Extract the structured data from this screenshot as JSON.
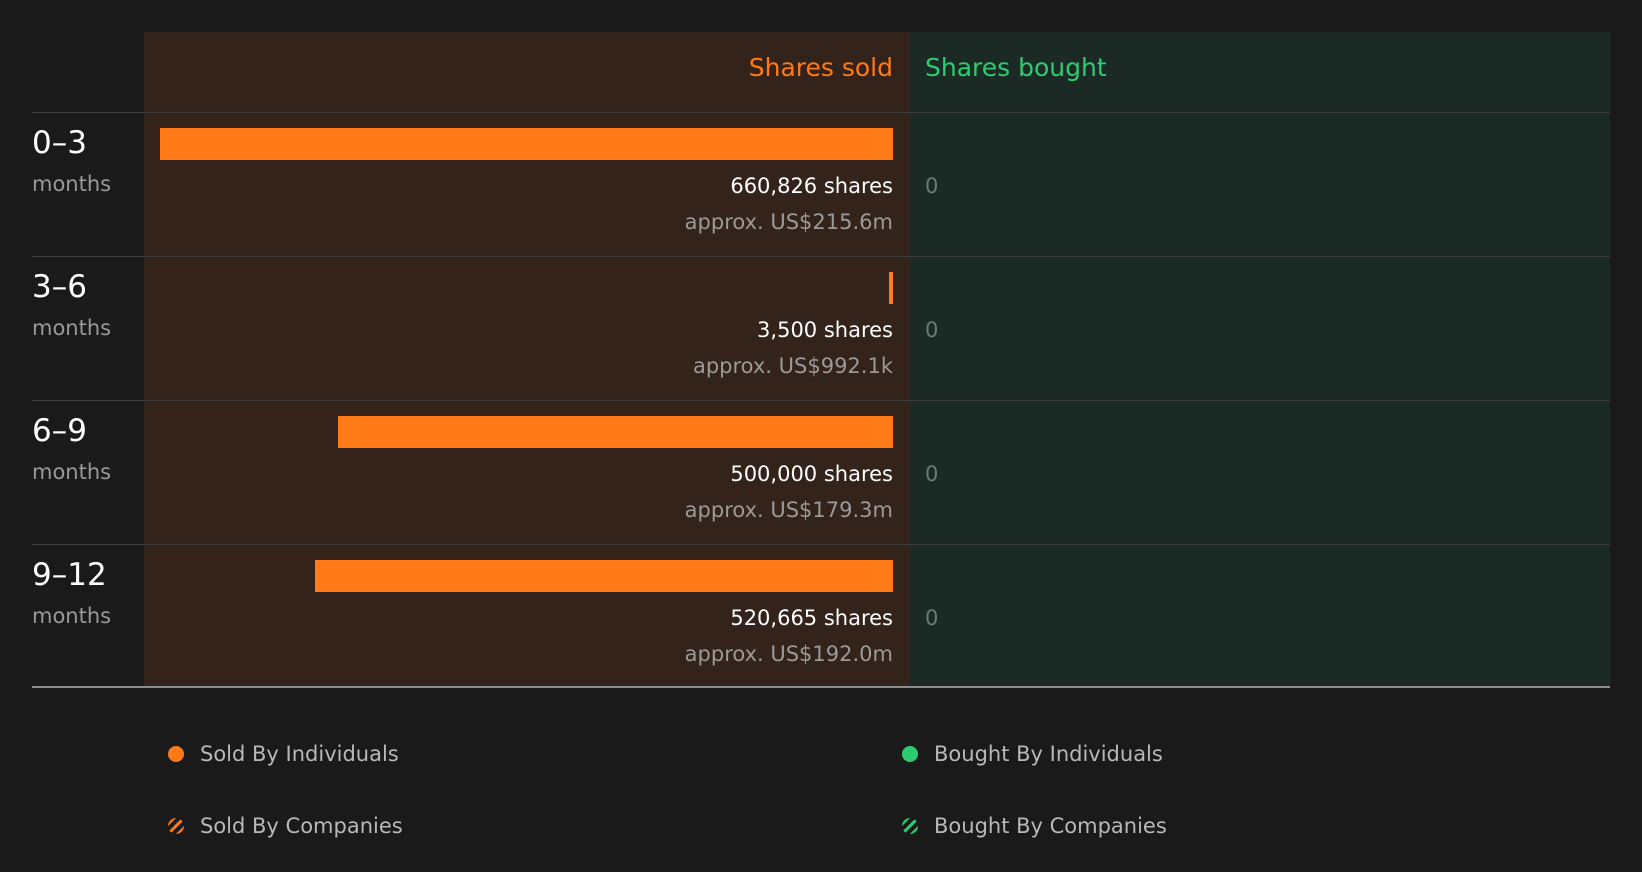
{
  "chart_data": {
    "type": "bar",
    "headers": {
      "sold": "Shares sold",
      "bought": "Shares bought"
    },
    "categories": [
      "0–3",
      "3–6",
      "6–9",
      "9–12"
    ],
    "rows": [
      {
        "range": "0–3",
        "unit": "months",
        "sold_shares": 660826,
        "sold_shares_label": "660,826 shares",
        "sold_value_label": "approx. US$215.6m",
        "bought_label": "0"
      },
      {
        "range": "3–6",
        "unit": "months",
        "sold_shares": 3500,
        "sold_shares_label": "3,500 shares",
        "sold_value_label": "approx. US$992.1k",
        "bought_label": "0"
      },
      {
        "range": "6–9",
        "unit": "months",
        "sold_shares": 500000,
        "sold_shares_label": "500,000 shares",
        "sold_value_label": "approx. US$179.3m",
        "bought_label": "0"
      },
      {
        "range": "9–12",
        "unit": "months",
        "sold_shares": 520665,
        "sold_shares_label": "520,665 shares",
        "sold_value_label": "approx. US$192.0m",
        "bought_label": "0"
      }
    ],
    "series": [
      {
        "name": "Sold By Individuals",
        "values": [
          660826,
          3500,
          500000,
          520665
        ]
      },
      {
        "name": "Sold By Companies",
        "values": [
          0,
          0,
          0,
          0
        ]
      },
      {
        "name": "Bought By Individuals",
        "values": [
          0,
          0,
          0,
          0
        ]
      },
      {
        "name": "Bought By Companies",
        "values": [
          0,
          0,
          0,
          0
        ]
      }
    ],
    "legend": [
      {
        "label": "Sold By Individuals",
        "style": "solid",
        "color": "#ff7a17"
      },
      {
        "label": "Bought By Individuals",
        "style": "solid",
        "color": "#2ecc71"
      },
      {
        "label": "Sold By Companies",
        "style": "striped",
        "color": "#ff7a17"
      },
      {
        "label": "Bought By Companies",
        "style": "striped",
        "color": "#2ecc71"
      }
    ],
    "xlim": [
      0,
      660826
    ],
    "legend_placement": "bottom"
  },
  "colors": {
    "sold": "#ff7a17",
    "bought": "#2ecc71"
  }
}
